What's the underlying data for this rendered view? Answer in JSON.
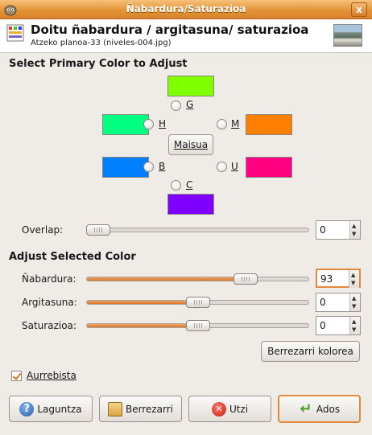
{
  "window": {
    "title": "Ñabardura/Saturazioa",
    "close_label": "x"
  },
  "header": {
    "title": "Doitu ñabardura / argitasuna/ saturazioa",
    "subtitle": "Atzeko planoa-33 (niveles-004.jpg)"
  },
  "primary": {
    "heading": "Select Primary Color to Adjust",
    "colors": {
      "G": "#80ff00",
      "H": "#00ff80",
      "M": "#ff8000",
      "B": "#0080ff",
      "U": "#ff0080",
      "C": "#8000ff"
    },
    "labels": {
      "G": "G",
      "H": "H",
      "M": "M",
      "B": "B",
      "U": "U",
      "C": "C"
    },
    "master_label": "Maisua"
  },
  "overlap": {
    "label": "Overlap:",
    "value": "0",
    "fraction": 0.0
  },
  "adjust": {
    "heading": "Adjust Selected Color",
    "hue": {
      "label": "Ñabardura:",
      "value": "93",
      "fraction": 0.74
    },
    "lightness": {
      "label": "Argitasuna:",
      "value": "0",
      "fraction": 0.5
    },
    "saturation": {
      "label": "Saturazioa:",
      "value": "0",
      "fraction": 0.5
    },
    "reset_color_label": "Berrezarri kolorea"
  },
  "preview": {
    "label": "Aurrebista",
    "checked": true
  },
  "buttons": {
    "help": "Laguntza",
    "reset": "Berrezarri",
    "cancel": "Utzi",
    "ok": "Ados"
  },
  "accent": "#e08a3c"
}
